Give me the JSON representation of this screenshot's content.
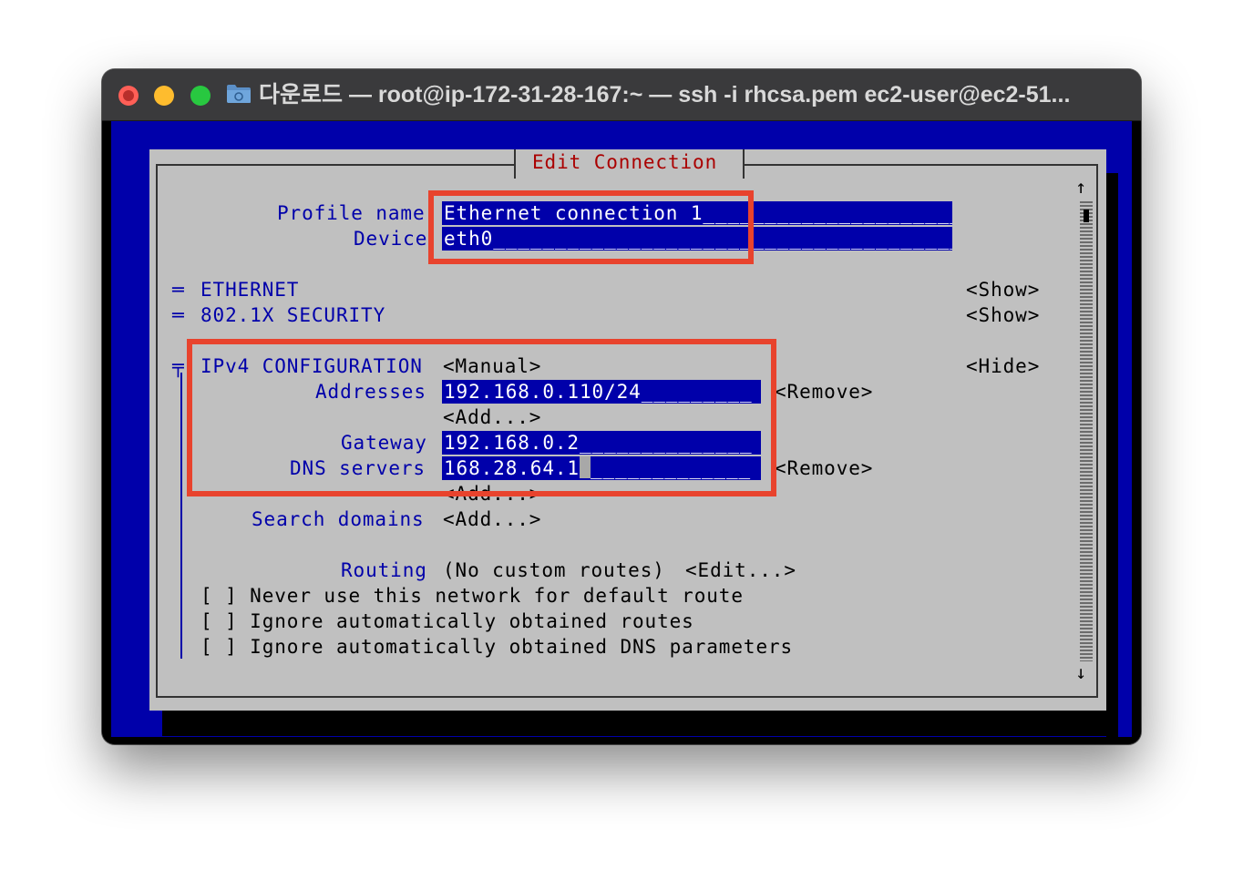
{
  "window": {
    "title": "다운로드 — root@ip-172-31-28-167:~ — ssh -i rhcsa.pem ec2-user@ec2-51..."
  },
  "dialog": {
    "title": "Edit Connection",
    "profile_name_label": "Profile name",
    "profile_name_value": "Ethernet connection 1",
    "profile_name_fill": "________________________",
    "device_label": "Device",
    "device_value": "eth0",
    "device_fill": "_________________________________________",
    "ethernet_marker": "═",
    "ethernet_label": "ETHERNET",
    "ethernet_action": "<Show>",
    "security_marker": "═",
    "security_label": "802.1X SECURITY",
    "security_action": "<Show>",
    "ipv4_marker": "╤",
    "ipv4_label": "IPv4 CONFIGURATION",
    "ipv4_mode": "<Manual>",
    "ipv4_action": "<Hide>",
    "addresses_label": "Addresses",
    "addresses_value": "192.168.0.110/24",
    "addresses_fill": "_________",
    "addresses_remove": "<Remove>",
    "addresses_add": "<Add...>",
    "gateway_label": "Gateway",
    "gateway_value": "192.168.0.2",
    "gateway_fill": "______________",
    "dns_label": "DNS servers",
    "dns_value": "168.28.64.1",
    "dns_fill": "_____________",
    "dns_remove": "<Remove>",
    "dns_add": "<Add...>",
    "search_label": "Search domains",
    "search_add": "<Add...>",
    "routing_label": "Routing",
    "routing_value": "(No custom routes)",
    "routing_edit": "<Edit...>",
    "check1": "[ ] Never use this network for default route",
    "check2": "[ ] Ignore automatically obtained routes",
    "check3": "[ ] Ignore automatically obtained DNS parameters",
    "scroll_up": "↑",
    "scroll_down": "↓"
  },
  "colors": {
    "terminal_blue": "#0000aa",
    "dialog_gray": "#c0c0c0",
    "title_red": "#aa0000",
    "highlight_red": "#e8432d"
  },
  "icons": [
    "folder-icon",
    "scroll-up-arrow-icon",
    "scroll-down-arrow-icon"
  ]
}
